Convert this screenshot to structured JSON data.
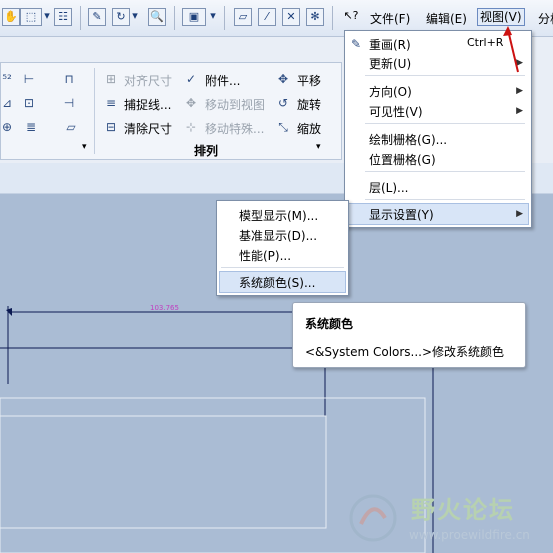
{
  "menubar": {
    "file": "文件(F)",
    "edit": "编辑(E)",
    "view": "视图(V)",
    "analysis": "分析"
  },
  "ribbon": {
    "align_dim": "对齐尺寸",
    "attach": "附件...",
    "translate": "平移",
    "capture_line": "捕捉线...",
    "move_to_view": "移动到视图",
    "rotate": "旋转",
    "clear_dim": "清除尺寸",
    "move_special": "移动特殊...",
    "scale": "缩放",
    "group_label": "排列"
  },
  "view_menu": {
    "redraw": "重画(R)",
    "redraw_shortcut": "Ctrl+R",
    "update": "更新(U)",
    "orientation": "方向(O)",
    "visibility": "可见性(V)",
    "draw_grid": "绘制栅格(G)...",
    "position_grid": "位置栅格(G)",
    "layer": "层(L)...",
    "display_settings": "显示设置(Y)"
  },
  "submenu": {
    "model_display": "模型显示(M)...",
    "datum_display": "基准显示(D)...",
    "performance": "性能(P)...",
    "system_colors": "系统颜色(S)..."
  },
  "tooltip": {
    "title": "系统颜色",
    "body": "<&System Colors...>修改系统颜色"
  },
  "canvas": {
    "dimension_value": "103.765"
  },
  "watermark": {
    "name": "野火论坛",
    "url": "www.proewildfire.cn"
  },
  "colors": {
    "canvas_bg": "#aabcd4",
    "accent_red": "#cc1111"
  }
}
